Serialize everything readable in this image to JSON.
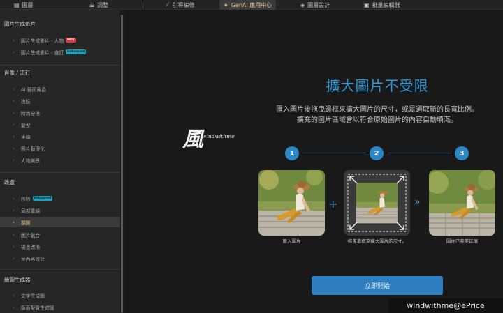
{
  "topbar": {
    "tabs": [
      {
        "label": "圖層",
        "icon": "layers-icon"
      },
      {
        "label": "調整",
        "icon": "sliders-icon"
      },
      {
        "label": "引導編修",
        "icon": "wand-icon"
      },
      {
        "label": "GenAI 應用中心",
        "icon": "sparkle-icon",
        "active": true
      },
      {
        "label": "圖層設計",
        "icon": "layers-design-icon"
      },
      {
        "label": "批量編輯器",
        "icon": "batch-icon"
      }
    ]
  },
  "sidebar": {
    "sections": [
      {
        "title": "圖片生成影片",
        "items": [
          {
            "label": "圖片生成影片 - 人物",
            "badge": "HOT"
          },
          {
            "label": "圖片生成影片 - 自訂",
            "badge": "Enhanced"
          }
        ]
      },
      {
        "title": "肖像 / 流行",
        "items": [
          {
            "label": "AI 藝術角色"
          },
          {
            "label": "換臉"
          },
          {
            "label": "時尚穿搭"
          },
          {
            "label": "髮型"
          },
          {
            "label": "手繪"
          },
          {
            "label": "照片動漫化"
          },
          {
            "label": "人物美景"
          }
        ]
      },
      {
        "title": "改造",
        "items": [
          {
            "label": "移除",
            "badge": "Enhanced"
          },
          {
            "label": "局部重繪"
          },
          {
            "label": "擴圖",
            "active": true
          },
          {
            "label": "圖片融合"
          },
          {
            "label": "場景改換"
          },
          {
            "label": "室內再設計"
          }
        ]
      },
      {
        "title": "繪圖生成器",
        "items": [
          {
            "label": "文字生成圖"
          },
          {
            "label": "版面配置生成圖"
          }
        ]
      }
    ]
  },
  "main": {
    "logo_char": "風",
    "logo_text": "windwithme",
    "title": "擴大圖片不受限",
    "desc_line1": "匯入圖片後拖曳邊框來擴大圖片的尺寸，或是選取新的長寬比例。",
    "desc_line2": "擴充的圖片區域會以符合原始圖片的內容自動填滿。",
    "steps": [
      "1",
      "2",
      "3"
    ],
    "captions": [
      "匯入圖片",
      "拖曳邊框來擴大圖片的尺寸。",
      "圖片已完美延展"
    ],
    "plus": "+",
    "arrows": "»",
    "start_label": "立即開始"
  },
  "watermark": "windwithme@ePrice"
}
